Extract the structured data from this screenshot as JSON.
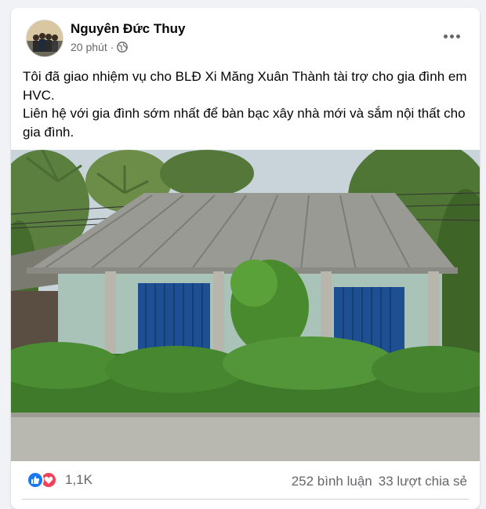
{
  "post": {
    "author": "Nguyên Đức Thuy",
    "time": "20 phút ·",
    "text_lines": [
      "Tôi đã giao nhiệm vụ cho BLĐ  Xi Măng Xuân Thành tài trợ cho gia đình em HVC.",
      "Liên hệ với gia đình sớm nhất để bàn bạc xây nhà mới và sắm nội thất cho gia đình."
    ]
  },
  "footer": {
    "reaction_count": "1,1K",
    "comments": "252 bình luận",
    "shares": "33 lượt chia sẻ"
  },
  "icons": {
    "privacy": "globe-icon",
    "more": "more-options-icon",
    "like": "like-reaction-icon",
    "love": "love-reaction-icon"
  },
  "colors": {
    "like": "#1877f2",
    "love": "#f33e58",
    "meta_text": "#65676b"
  }
}
